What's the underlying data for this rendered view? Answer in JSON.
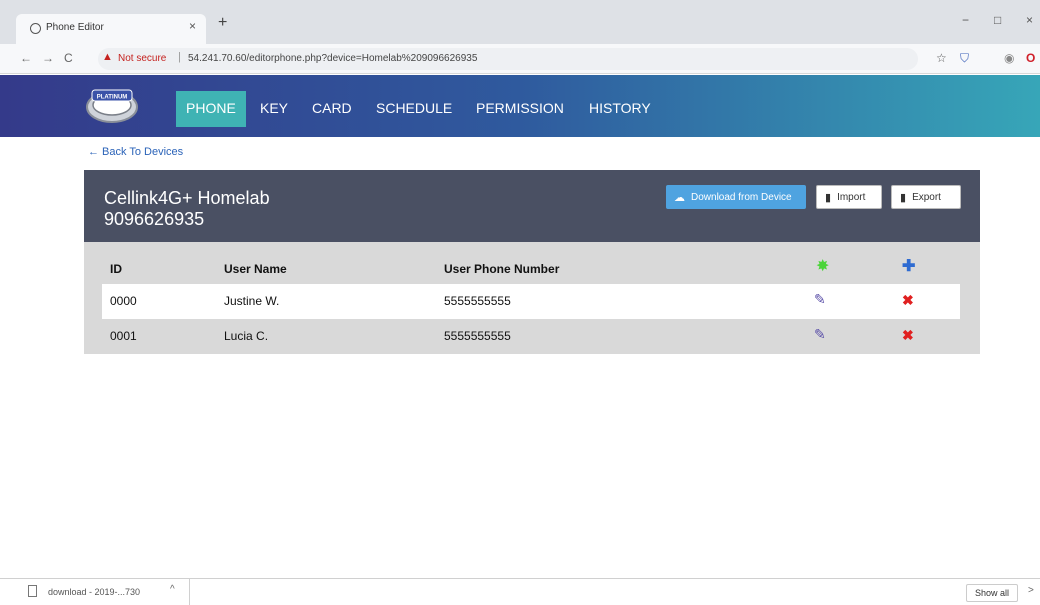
{
  "browser": {
    "tab_title": "Phone Editor",
    "tab_close": "×",
    "new_tab": "+",
    "win_minimize": "−",
    "win_maximize": "□",
    "win_close": "×",
    "nav_back": "←",
    "nav_forward": "→",
    "nav_reload": "C",
    "security_label": "Not secure",
    "url_separator": "|",
    "url": "54.241.70.60/editorphone.php?device=Homelab%209096626935",
    "star_icon": "☆",
    "shield_icon": "⛉",
    "profile_icon": "◉",
    "opera_icon": "O"
  },
  "app": {
    "logo_text": "PLATINUM",
    "nav": [
      {
        "label": "PHONE",
        "active": true
      },
      {
        "label": "KEY",
        "active": false
      },
      {
        "label": "CARD",
        "active": false
      },
      {
        "label": "SCHEDULE",
        "active": false
      },
      {
        "label": "PERMISSION",
        "active": false
      },
      {
        "label": "HISTORY",
        "active": false
      }
    ]
  },
  "back_link": "← Back To Devices",
  "device": {
    "name": "Cellink4G+ Homelab",
    "phone": "9096626935"
  },
  "buttons": {
    "download": "Download from Device",
    "import": "Import",
    "export": "Export"
  },
  "table": {
    "headers": {
      "id": "ID",
      "user_name": "User Name",
      "phone_number": "User Phone Number"
    },
    "rows": [
      {
        "id": "0000",
        "user_name": "Justine W.",
        "phone_number": "5555555555"
      },
      {
        "id": "0001",
        "user_name": "Lucia C.",
        "phone_number": "5555555555"
      }
    ]
  },
  "download_bar": {
    "file_label": "download - 2019-...730",
    "chevron": "^",
    "show_all": "Show all",
    "close": ">"
  },
  "colors": {
    "header_start": "#343a8a",
    "header_end": "#37a6b8",
    "active_tab": "#3fb3b4",
    "device_panel": "#4a5063",
    "download_button": "#4fa3e0",
    "delete_icon": "#e02020",
    "add_icon": "#2e6bd1",
    "starburst_icon": "#4cd43a"
  }
}
